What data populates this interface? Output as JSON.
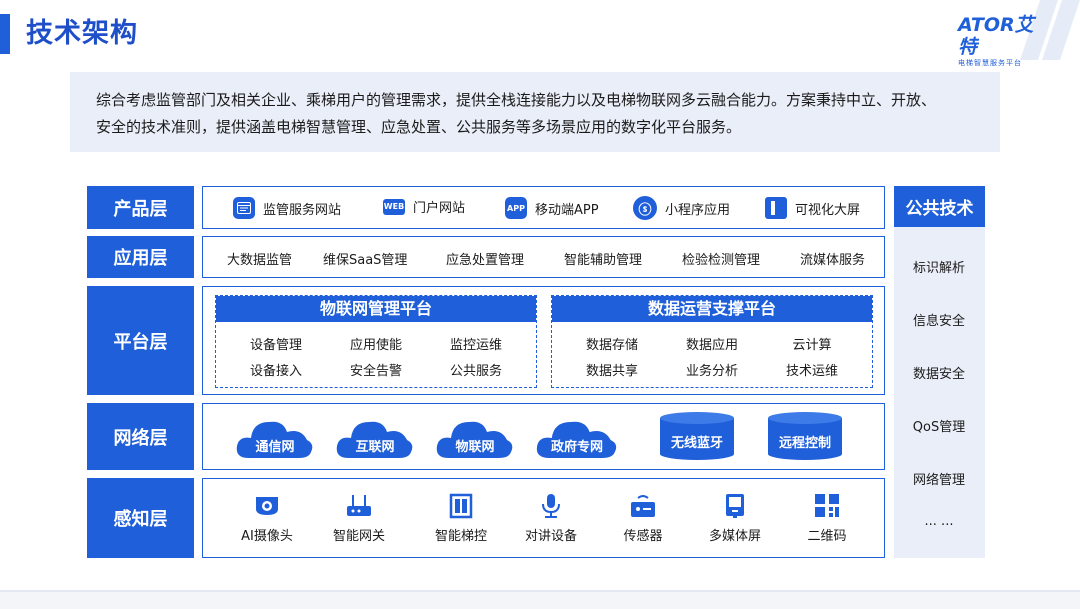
{
  "page": {
    "title": "技术架构",
    "logo_main": "ATOR艾特",
    "logo_sub": "电梯智慧服务平台",
    "intro_line1": "综合考虑监管部门及相关企业、乘梯用户的管理需求，提供全栈连接能力以及电梯物联网多云融合能力。方案秉持中立、开放、",
    "intro_line2": "安全的技术准则，提供涵盖电梯智慧管理、应急处置、公共服务等多场景应用的数字化平台服务。"
  },
  "layers": {
    "product": {
      "label": "产品层",
      "items": [
        {
          "label": "监管服务网站",
          "icon": "browser-icon",
          "icon_text": ""
        },
        {
          "label": "门户网站",
          "icon": "web-icon",
          "icon_text": "WEB"
        },
        {
          "label": "移动端APP",
          "icon": "app-icon",
          "icon_text": "APP"
        },
        {
          "label": "小程序应用",
          "icon": "mini-program-icon",
          "icon_text": "ⓢ"
        },
        {
          "label": "可视化大屏",
          "icon": "screen-icon",
          "icon_text": ""
        }
      ]
    },
    "application": {
      "label": "应用层",
      "items": [
        "大数据监管",
        "维保SaaS管理",
        "应急处置管理",
        "智能辅助管理",
        "检验检测管理",
        "流媒体服务"
      ]
    },
    "platform": {
      "label": "平台层",
      "iot": {
        "title": "物联网管理平台",
        "row1": [
          "设备管理",
          "应用使能",
          "监控运维"
        ],
        "row2": [
          "设备接入",
          "安全告警",
          "公共服务"
        ]
      },
      "ops": {
        "title": "数据运营支撑平台",
        "row1": [
          "数据存储",
          "数据应用",
          "云计算"
        ],
        "row2": [
          "数据共享",
          "业务分析",
          "技术运维"
        ]
      }
    },
    "network": {
      "label": "网络层",
      "clouds": [
        "通信网",
        "互联网",
        "物联网",
        "政府专网"
      ],
      "cylinders": [
        "无线蓝牙",
        "远程控制"
      ]
    },
    "sensing": {
      "label": "感知层",
      "items": [
        {
          "label": "AI摄像头",
          "icon": "camera-icon"
        },
        {
          "label": "智能网关",
          "icon": "gateway-icon"
        },
        {
          "label": "智能梯控",
          "icon": "elevator-icon"
        },
        {
          "label": "对讲设备",
          "icon": "microphone-icon"
        },
        {
          "label": "传感器",
          "icon": "sensor-icon"
        },
        {
          "label": "多媒体屏",
          "icon": "media-screen-icon"
        },
        {
          "label": "二维码",
          "icon": "qrcode-icon"
        }
      ]
    }
  },
  "public_tech": {
    "label": "公共技术",
    "items": [
      "标识解析",
      "信息安全",
      "数据安全",
      "QoS管理",
      "网络管理",
      "... ..."
    ]
  },
  "colors": {
    "primary": "#1f5fd9",
    "light_bg": "#e9eef8"
  }
}
